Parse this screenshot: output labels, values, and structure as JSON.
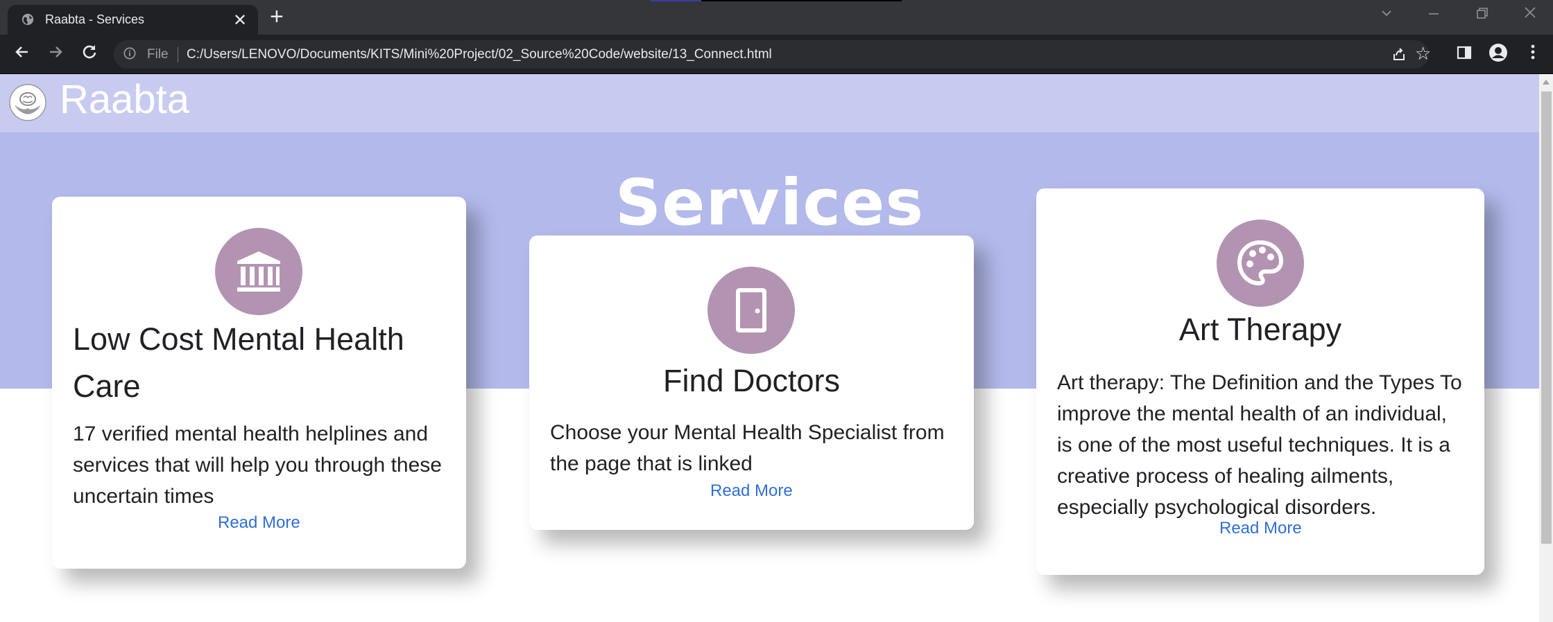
{
  "browser": {
    "tab_title": "Raabta - Services",
    "new_tab_symbol": "+",
    "close_symbol": "✕",
    "address_scheme_label": "File",
    "url": "C:/Users/LENOVO/Documents/KITS/Mini%20Project/02_Source%20Code/website/13_Connect.html",
    "icons": [
      "globe-icon",
      "back-icon",
      "forward-icon",
      "reload-icon",
      "info-icon",
      "share-icon",
      "star-icon",
      "sidebar-icon",
      "profile-icon",
      "menu-icon",
      "chevron-down-icon",
      "minimize-icon",
      "restore-icon",
      "close-window-icon"
    ]
  },
  "site": {
    "brand": "Raabta",
    "hero_title": "Services",
    "colors": {
      "header_bg": "#c8cbf0",
      "hero_bg": "#b3b9ea",
      "icon_circle": "#b393b2",
      "link": "#2f6fd6"
    }
  },
  "cards": [
    {
      "icon": "bank-icon",
      "title_line1": "Low Cost Mental Health",
      "title_line2": "Care",
      "text_lines": [
        "17 verified mental health helplines and",
        "services that will help you through these",
        "uncertain times"
      ],
      "link": "Read More"
    },
    {
      "icon": "door-icon",
      "title": "Find Doctors",
      "text_lines": [
        "Choose your Mental Health Specialist from",
        "the page that is linked"
      ],
      "link": "Read More"
    },
    {
      "icon": "palette-icon",
      "title": "Art Therapy",
      "text_lines": [
        "Art therapy: The Definition and the Types To",
        "improve the mental health of an individual,",
        "is one of the most useful techniques. It is a",
        "creative process of healing ailments,",
        "especially psychological disorders."
      ],
      "link": "Read More"
    }
  ]
}
